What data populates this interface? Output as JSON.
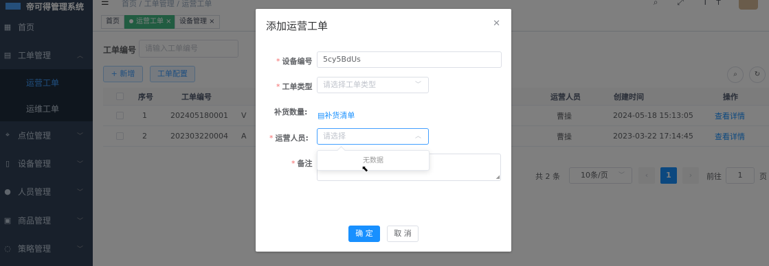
{
  "app": {
    "title": "帝可得管理系统"
  },
  "sidebar": {
    "items": [
      {
        "label": "首页",
        "icon": "dashboard-icon",
        "glyph": "▦"
      },
      {
        "label": "工单管理",
        "icon": "ticket-icon",
        "glyph": "▤",
        "expanded": true
      },
      {
        "label": "点位管理",
        "icon": "location-icon",
        "glyph": "⌖"
      },
      {
        "label": "设备管理",
        "icon": "device-icon",
        "glyph": "▯"
      },
      {
        "label": "人员管理",
        "icon": "people-icon",
        "glyph": "●"
      },
      {
        "label": "商品管理",
        "icon": "goods-icon",
        "glyph": "▣"
      },
      {
        "label": "策略管理",
        "icon": "strategy-icon",
        "glyph": "◌"
      }
    ],
    "sub_items": [
      {
        "label": "运营工单",
        "active": true
      },
      {
        "label": "运维工单",
        "active": false
      }
    ]
  },
  "header": {
    "breadcrumb": "首页 / 工单管理 / 运营工单",
    "icons": "⌕ ⤢ Tт"
  },
  "tags": [
    {
      "label": "首页"
    },
    {
      "label": "运营工单 ×",
      "active": true
    },
    {
      "label": "设备管理 ×"
    }
  ],
  "search": {
    "label": "工单编号",
    "placeholder": "请输入工单编号"
  },
  "toolbar": {
    "add_label": "+ 新增",
    "config_label": "工单配置"
  },
  "table": {
    "columns": [
      "序号",
      "工单编号",
      "运营人员",
      "创建时间",
      "操作"
    ],
    "rows": [
      {
        "index": "1",
        "code": "202405180001",
        "extra": "V",
        "person": "曹操",
        "time": "2024-05-18 15:13:05",
        "action": "查看详情"
      },
      {
        "index": "2",
        "code": "202303220004",
        "extra": "A",
        "person": "曹操",
        "time": "2023-03-22 17:14:45",
        "action": "查看详情"
      }
    ]
  },
  "pager": {
    "total": "共 2 条",
    "size": "10条/页",
    "page": "1",
    "goto": "前往",
    "goto_value": "1",
    "page_suffix": "页"
  },
  "dialog": {
    "title": "添加运营工单",
    "fields": {
      "device_code": {
        "label": "设备编号",
        "value": "5cy5BdUs"
      },
      "type": {
        "label": "工单类型",
        "placeholder": "请选择工单类型"
      },
      "supply": {
        "label": "补货数量:",
        "link": "补货清单"
      },
      "person": {
        "label": "运营人员:",
        "placeholder": "请选择"
      },
      "remark": {
        "label": "备注"
      }
    },
    "dropdown_empty": "无数据",
    "ok_label": "确 定",
    "cancel_label": "取 消"
  }
}
